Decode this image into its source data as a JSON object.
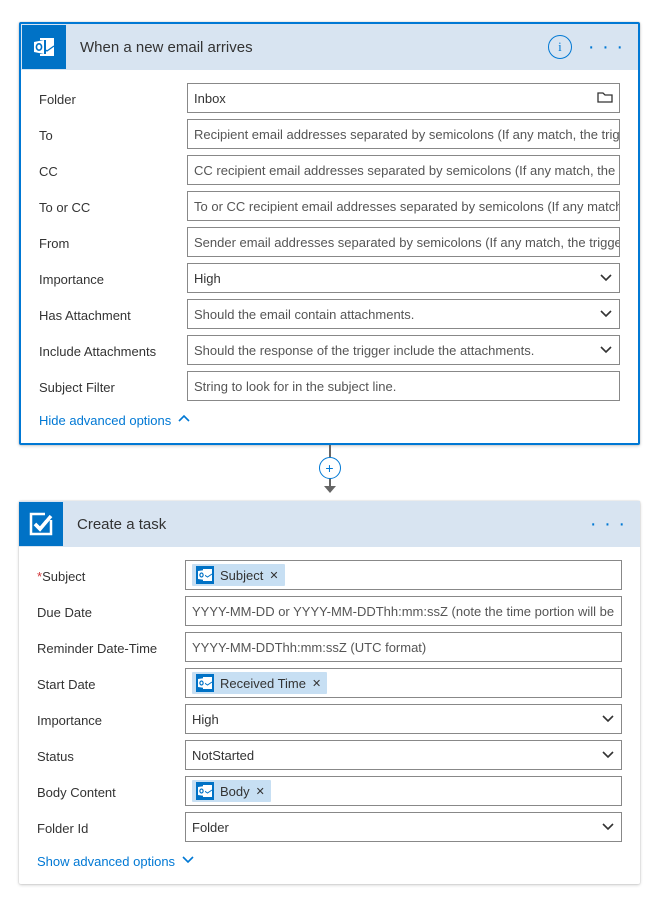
{
  "trigger": {
    "title": "When a new email arrives",
    "fields": {
      "folder_label": "Folder",
      "folder_value": "Inbox",
      "to_label": "To",
      "to_placeholder": "Recipient email addresses separated by semicolons (If any match, the trigger...",
      "cc_label": "CC",
      "cc_placeholder": "CC recipient email addresses separated by semicolons (If any match, the trig...",
      "toorcc_label": "To or CC",
      "toorcc_placeholder": "To or CC recipient email addresses separated by semicolons (If any match, th...",
      "from_label": "From",
      "from_placeholder": "Sender email addresses separated by semicolons (If any match, the trigger wi...",
      "importance_label": "Importance",
      "importance_value": "High",
      "hasatt_label": "Has Attachment",
      "hasatt_placeholder": "Should the email contain attachments.",
      "includeatt_label": "Include Attachments",
      "includeatt_placeholder": "Should the response of the trigger include the attachments.",
      "subjectfilter_label": "Subject Filter",
      "subjectfilter_placeholder": "String to look for in the subject line."
    },
    "toggle_link": "Hide advanced options"
  },
  "action": {
    "title": "Create a task",
    "fields": {
      "subject_label": "Subject",
      "subject_token": "Subject",
      "duedate_label": "Due Date",
      "duedate_placeholder": "YYYY-MM-DD or YYYY-MM-DDThh:mm:ssZ (note the time portion will be",
      "reminder_label": "Reminder Date-Time",
      "reminder_placeholder": "YYYY-MM-DDThh:mm:ssZ (UTC format)",
      "startdate_label": "Start Date",
      "startdate_token": "Received Time",
      "importance_label": "Importance",
      "importance_value": "High",
      "status_label": "Status",
      "status_value": "NotStarted",
      "bodycontent_label": "Body Content",
      "bodycontent_token": "Body",
      "folderid_label": "Folder Id",
      "folderid_value": "Folder"
    },
    "toggle_link": "Show advanced options"
  }
}
